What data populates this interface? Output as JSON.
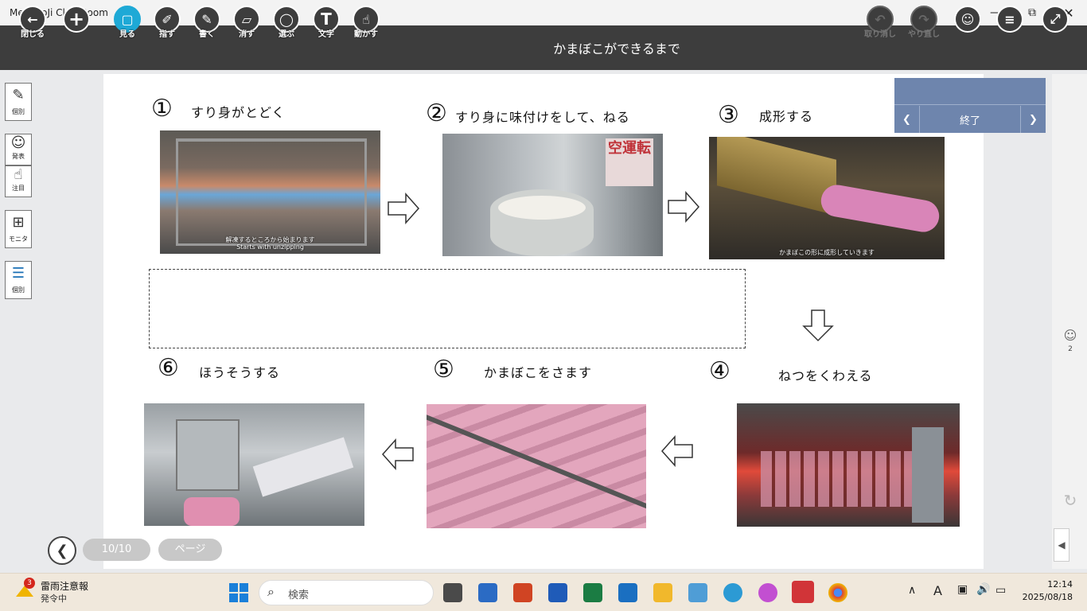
{
  "window": {
    "title": "MetaMoJi ClassRoom"
  },
  "toolbar": {
    "close_label": "閉じる",
    "view_label": "見る",
    "point_label": "指す",
    "write_label": "書く",
    "erase_label": "消す",
    "select_label": "選ぶ",
    "text_label": "文字",
    "move_label": "動かす",
    "undo_label": "取り消し",
    "redo_label": "やり直し",
    "document_title": "かまぼこができるまで"
  },
  "panel": {
    "end_label": "終了"
  },
  "steps": [
    {
      "num": "①",
      "label": "すり身がとどく",
      "caption": "解凍するところから始まります",
      "caption_en": "Starts with unzipping"
    },
    {
      "num": "②",
      "label": "すり身に味付けをして、ねる",
      "caption": "",
      "sign": "空運転"
    },
    {
      "num": "③",
      "label": "成形する",
      "caption": "かまぼこの形に成形していきます"
    },
    {
      "num": "④",
      "label": "ねつをくわえる"
    },
    {
      "num": "⑤",
      "label": "かまぼこをさます"
    },
    {
      "num": "⑥",
      "label": "ほうそうする"
    }
  ],
  "sidebar": {
    "individual1": "個別",
    "present": "発表",
    "attention": "注目",
    "monitor": "モニタ",
    "individual2": "個別",
    "user_count": "2"
  },
  "pager": {
    "page": "10/10",
    "page_btn": "ページ"
  },
  "taskbar": {
    "weather_title": "雷雨注意報",
    "weather_sub": "発令中",
    "weather_badge": "3",
    "search_placeholder": "検索",
    "ime": "A",
    "time": "12:14",
    "date": "2025/08/18"
  },
  "colors": {
    "toolbar": "#3d3d3d",
    "accent": "#1ea9d6",
    "panel": "#6e85ad"
  }
}
